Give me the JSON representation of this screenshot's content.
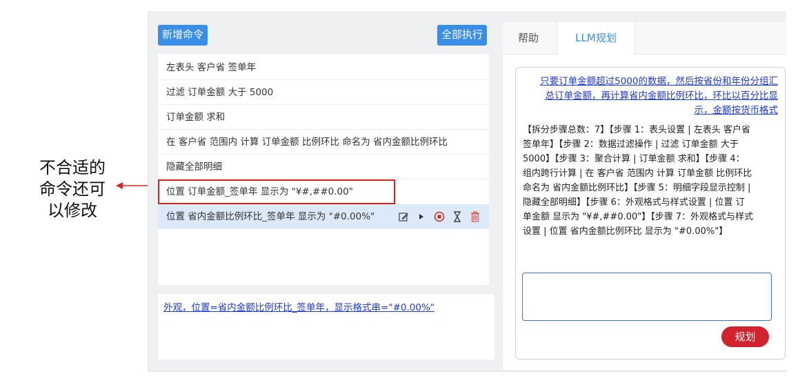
{
  "annotation": {
    "lines": [
      "不合适的",
      "命令还可",
      "以修改"
    ]
  },
  "toolbar": {
    "add_label": "新增命令",
    "run_all_label": "全部执行"
  },
  "commands": [
    "左表头 客户省 签单年",
    "过滤 订单金额 大于 5000",
    "订单金额 求和",
    "在 客户省 范围内 计算 订单金额 比例环比 命名为 省内金额比例环比",
    "隐藏全部明细",
    "位置 订单金额_签单年 显示为 \"¥#,##0.00\"",
    "位置 省内金额比例环比_签单年 显示为 \"#0.00%\""
  ],
  "selected_index": 6,
  "highlighted_index": 5,
  "bottom_link": "外观，位置=省内金额比例环比_签单年，显示格式串=\"#0.00%\"",
  "tabs": {
    "help": "帮助",
    "llm": "LLM规划"
  },
  "llm": {
    "prompt_lines": [
      "只要订单金额超过5000的数据，然后按省份和年份分组汇",
      "总订单金额，再计算省内金额比例环比，环比以百分比显",
      "示，金额按货币格式"
    ],
    "plan_lines": [
      "【拆分步骤总数：7】【步骤 1：表头设置 | 左表头 客户省",
      "签单年】【步骤 2：数据过滤操作 | 过滤 订单金额 大于",
      "5000】【步骤 3：聚合计算 | 订单金额 求和】【步骤 4：",
      "组内跨行计算 | 在 客户省 范围内 计算 订单金额 比例环比",
      "命名为 省内金额比例环比】【步骤 5：明细字段显示控制 |",
      "隐藏全部明细】【步骤 6：外观格式与样式设置 | 位置 订",
      "单金额 显示为 \"¥#,##0.00\"】【步骤 7：外观格式与样式",
      "设置 | 位置 省内金额比例环比 显示为 \"#0.00%\"】"
    ],
    "input_value": "",
    "plan_button": "规划"
  },
  "colors": {
    "accent": "#3a8ee6",
    "danger": "#d2222e",
    "link": "#1f3ad6",
    "highlight_border": "#d9251c"
  },
  "icons": {
    "row_actions": [
      "edit-icon",
      "play-icon",
      "stop-icon",
      "hourglass-icon",
      "trash-icon"
    ]
  }
}
